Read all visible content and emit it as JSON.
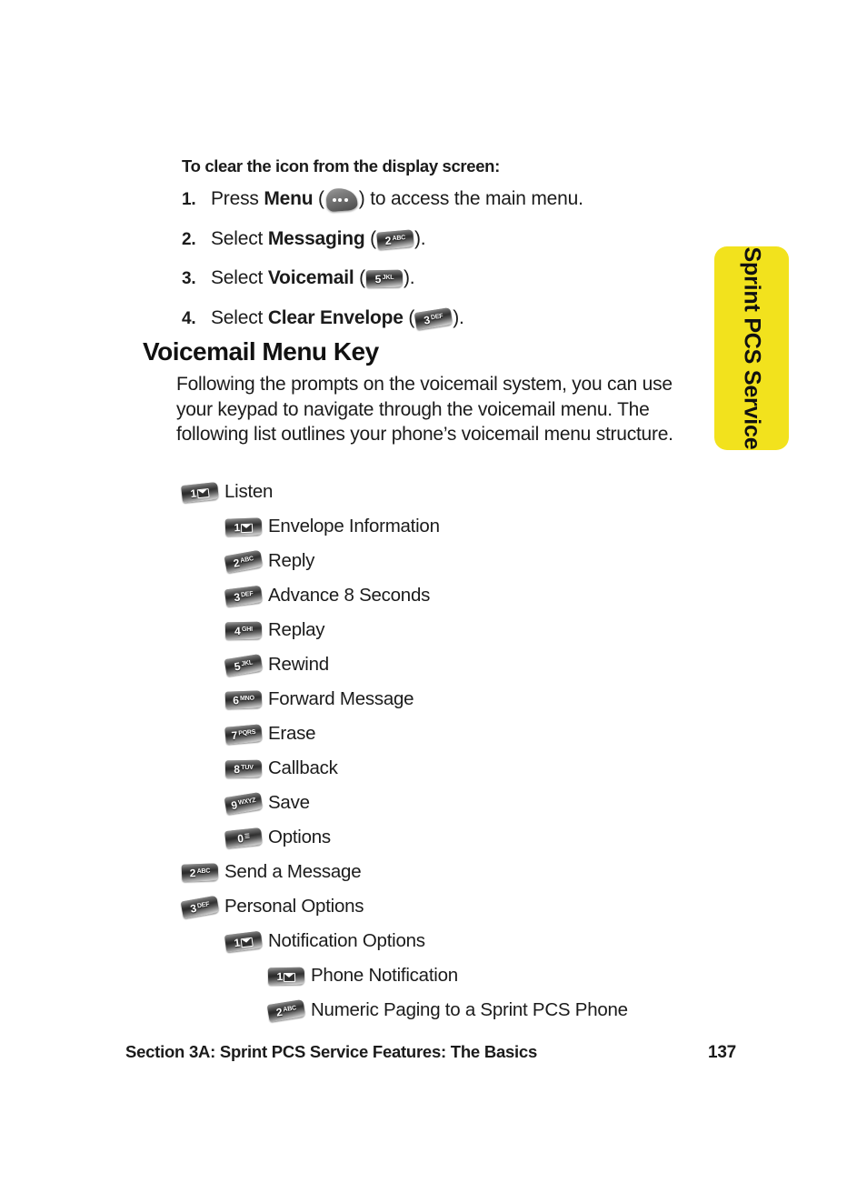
{
  "side_tab": {
    "label": "Sprint PCS Service",
    "color": "#f2e21d"
  },
  "intro": {
    "heading": "To clear the icon from the display screen:",
    "steps": [
      {
        "number": "1.",
        "text_before": "Press ",
        "bold": "Menu",
        "paren_open": " (",
        "key": "menu",
        "paren_close": ")",
        "text_after": " to access the main menu."
      },
      {
        "number": "2.",
        "text_before": "Select ",
        "bold": "Messaging",
        "paren_open": " (",
        "key": "2",
        "paren_close": ")",
        "text_after": "."
      },
      {
        "number": "3.",
        "text_before": "Select ",
        "bold": "Voicemail",
        "paren_open": " (",
        "key": "5",
        "paren_close": ")",
        "text_after": "."
      },
      {
        "number": "4.",
        "text_before": "Select ",
        "bold": "Clear Envelope",
        "paren_open": " (",
        "key": "3",
        "paren_close": ")",
        "text_after": "."
      }
    ]
  },
  "section": {
    "heading": "Voicemail Menu Key",
    "paragraph": "Following the prompts on the voicemail system, you can use your keypad to navigate through the voicemail menu. The following list outlines your phone’s voicemail menu structure."
  },
  "keys": {
    "1": {
      "digit": "1",
      "letters": "",
      "glyph": "envelope"
    },
    "2": {
      "digit": "2",
      "letters": "ABC",
      "glyph": ""
    },
    "3": {
      "digit": "3",
      "letters": "DEF",
      "glyph": ""
    },
    "4": {
      "digit": "4",
      "letters": "GHI",
      "glyph": ""
    },
    "5": {
      "digit": "5",
      "letters": "JKL",
      "glyph": ""
    },
    "6": {
      "digit": "6",
      "letters": "MNO",
      "glyph": ""
    },
    "7": {
      "digit": "7",
      "letters": "PQRS",
      "glyph": ""
    },
    "8": {
      "digit": "8",
      "letters": "TUV",
      "glyph": ""
    },
    "9": {
      "digit": "9",
      "letters": "WXYZ",
      "glyph": ""
    },
    "0": {
      "digit": "0",
      "letters": "",
      "glyph": "operator"
    },
    "menu": {
      "digit": "",
      "letters": "",
      "glyph": "menu-softkey"
    }
  },
  "menu_tree": [
    {
      "level": 0,
      "key": "1",
      "label": "Listen"
    },
    {
      "level": 1,
      "key": "1",
      "label": "Envelope Information"
    },
    {
      "level": 1,
      "key": "2",
      "label": "Reply"
    },
    {
      "level": 1,
      "key": "3",
      "label": "Advance 8 Seconds"
    },
    {
      "level": 1,
      "key": "4",
      "label": "Replay"
    },
    {
      "level": 1,
      "key": "5",
      "label": "Rewind"
    },
    {
      "level": 1,
      "key": "6",
      "label": "Forward Message"
    },
    {
      "level": 1,
      "key": "7",
      "label": "Erase"
    },
    {
      "level": 1,
      "key": "8",
      "label": "Callback"
    },
    {
      "level": 1,
      "key": "9",
      "label": "Save"
    },
    {
      "level": 1,
      "key": "0",
      "label": "Options"
    },
    {
      "level": 0,
      "key": "2",
      "label": "Send a Message"
    },
    {
      "level": 0,
      "key": "3",
      "label": "Personal Options"
    },
    {
      "level": 1,
      "key": "1",
      "label": "Notification Options"
    },
    {
      "level": 2,
      "key": "1",
      "label": "Phone Notification"
    },
    {
      "level": 2,
      "key": "2",
      "label": "Numeric Paging to a Sprint PCS Phone"
    }
  ],
  "footer": {
    "section_text": "Section 3A: Sprint PCS Service Features: The Basics",
    "page_number": "137"
  }
}
